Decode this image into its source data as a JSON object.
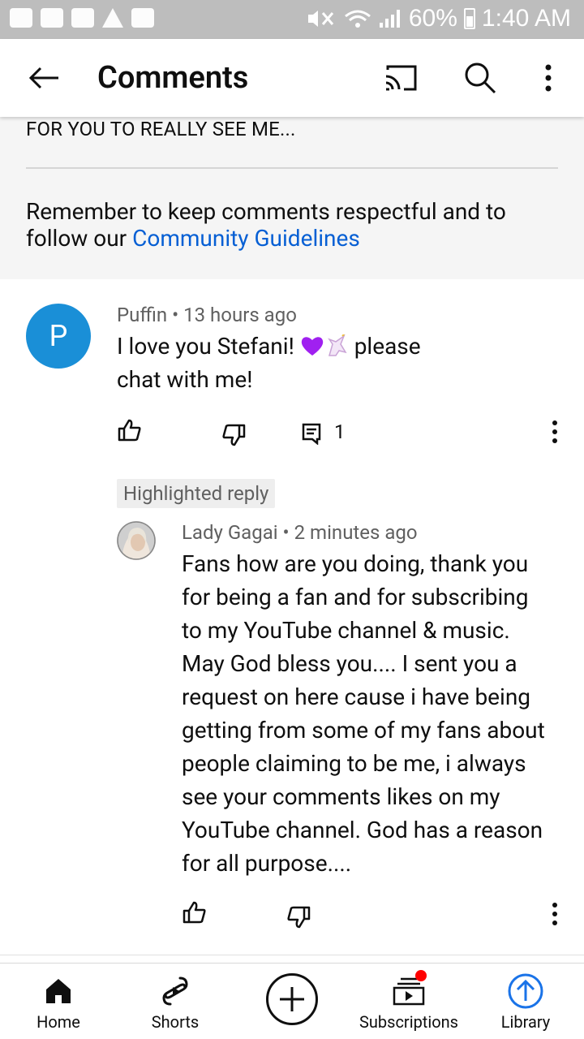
{
  "status_bar": {
    "battery": "60%",
    "time": "1:40 AM"
  },
  "app_bar": {
    "title": "Comments",
    "icons": [
      "back-arrow-icon",
      "cast-icon",
      "search-icon",
      "more-vert-icon"
    ]
  },
  "pinned": {
    "text": "FOR YOU TO REALLY SEE ME...",
    "reminder_prefix": "Remember to keep comments respectful and to follow our ",
    "reminder_link": "Community Guidelines"
  },
  "comment": {
    "avatar_letter": "P",
    "author": "Puffin",
    "separator": "•",
    "time": "13 hours ago",
    "text_line1_before": "I love you Stefani! ",
    "text_line1_after": " please",
    "text_line2": "chat with me!",
    "reply_count": "1"
  },
  "reply": {
    "chip": "Highlighted reply",
    "author": "Lady Gagai",
    "separator": "•",
    "time": "2 minutes ago",
    "lines": [
      "Fans how are you doing, thank you",
      "for being a fan and for subscribing",
      "to my YouTube channel & music.",
      "May God bless you.... I sent you a",
      "request  on here cause i have being",
      "getting from some of my fans about",
      "people claiming to be me, i always",
      "see your comments likes on my",
      "YouTube channel.  God has a reason",
      "for all purpose...."
    ]
  },
  "bottom_nav": {
    "home": "Home",
    "shorts": "Shorts",
    "subscriptions": "Subscriptions",
    "library": "Library"
  },
  "colors": {
    "link": "#065fd4",
    "avatar": "#1a8fd7",
    "library_active": "#1a73e8",
    "notification": "#ff0000"
  }
}
